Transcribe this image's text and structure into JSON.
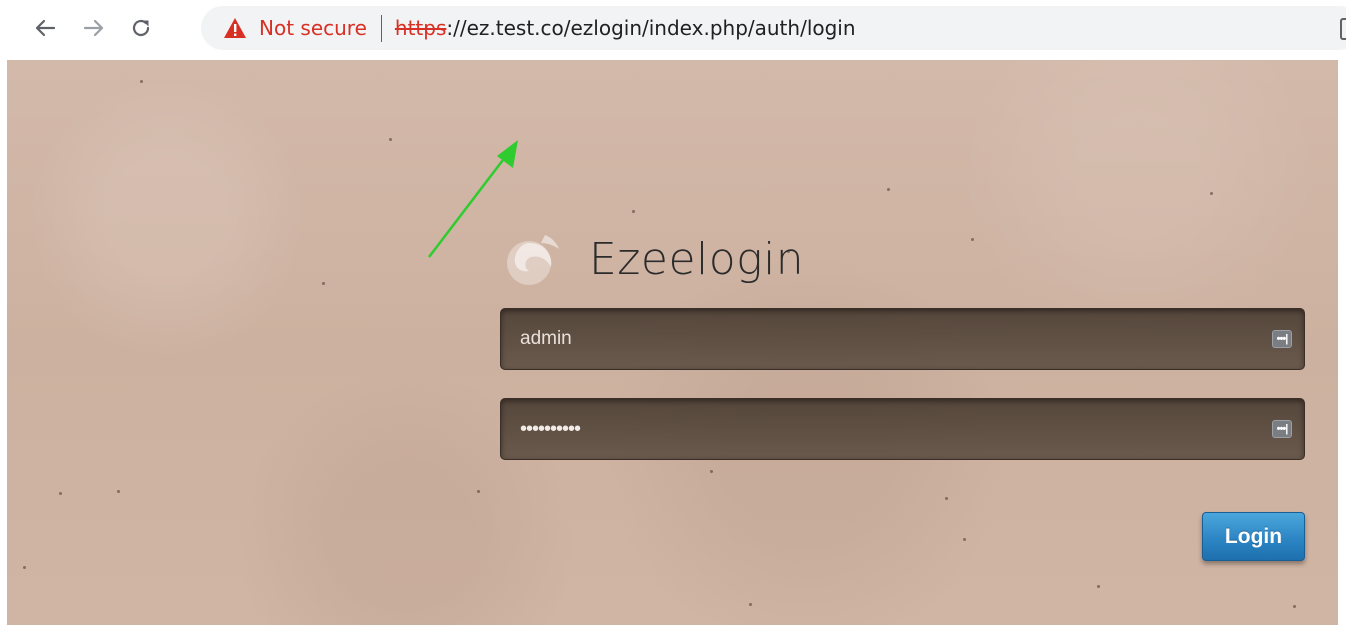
{
  "browser": {
    "security_label": "Not secure",
    "url_scheme": "https",
    "url_rest": "://ez.test.co/ezlogin/index.php/auth/login",
    "icons": [
      "back-arrow-icon",
      "forward-arrow-icon",
      "reload-icon",
      "warning-triangle-icon"
    ]
  },
  "login": {
    "brand_name": "Ezeelogin",
    "username_value": "admin",
    "password_value": "••••••••••",
    "login_button_label": "Login",
    "field_icon_glyph": "•••|"
  },
  "colors": {
    "warning_red": "#d93025",
    "button_blue": "#2d86c4",
    "annotation_arrow": "#2ecc2e"
  }
}
